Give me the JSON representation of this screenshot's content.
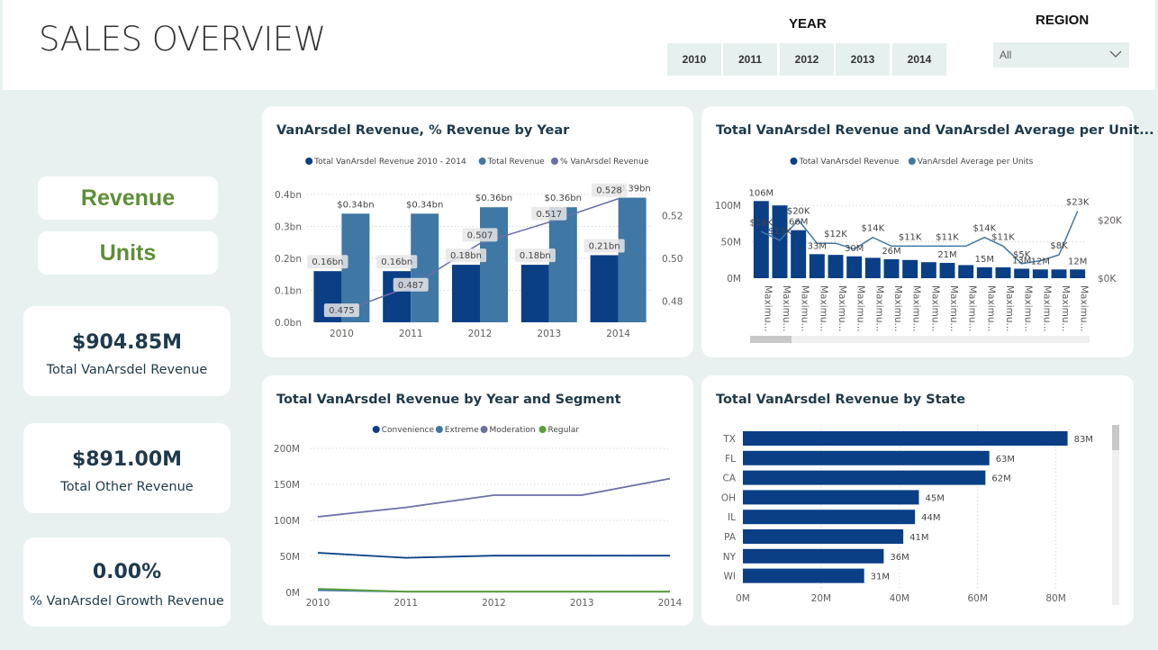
{
  "header": {
    "title": "SALES OVERVIEW",
    "year_slicer": {
      "title": "YEAR",
      "options": [
        "2010",
        "2011",
        "2012",
        "2013",
        "2014"
      ]
    },
    "region_slicer": {
      "title": "REGION",
      "selected": "All"
    }
  },
  "nav": {
    "revenue_label": "Revenue",
    "units_label": "Units"
  },
  "kpis": [
    {
      "value": "$904.85M",
      "label": "Total VanArsdel Revenue"
    },
    {
      "value": "$891.00M",
      "label": "Total Other Revenue"
    },
    {
      "value": "0.00%",
      "label": "% VanArsdel Growth Revenue"
    }
  ],
  "colors": {
    "dark_blue": "#0a3f86",
    "steel_blue": "#3f77a5",
    "purple": "#6b6fa5",
    "green": "#5c9e3b",
    "accent_green": "#5c8f36",
    "background": "#e8f1ef"
  },
  "charts": {
    "revenue_by_year": {
      "title": "VanArsdel Revenue, % Revenue by Year",
      "legend": [
        "Total VanArsdel Revenue 2010 - 2014",
        "Total Revenue",
        "% VanArsdel Revenue"
      ],
      "y_ticks": [
        "0.4bn",
        "0.3bn",
        "0.2bn",
        "0.1bn",
        "0.0bn"
      ],
      "y2_ticks": [
        "0.52",
        "0.50",
        "0.48"
      ]
    },
    "revenue_avg_per_unit": {
      "title": "Total VanArsdel Revenue and VanArsdel Average per Unit...",
      "legend": [
        "Total VanArsdel Revenue",
        "VanArsdel Average per Units"
      ],
      "y_ticks": [
        "100M",
        "50M",
        "0M"
      ],
      "y2_ticks": [
        "$20K",
        "$0K"
      ]
    },
    "revenue_by_segment": {
      "title": "Total VanArsdel Revenue by Year and Segment",
      "legend": [
        "Convenience",
        "Extreme",
        "Moderation",
        "Regular"
      ]
    },
    "revenue_by_state": {
      "title": "Total VanArsdel Revenue by State"
    }
  },
  "chart_data": [
    {
      "type": "bar",
      "title": "VanArsdel Revenue, % Revenue by Year",
      "categories": [
        "2010",
        "2011",
        "2012",
        "2013",
        "2014"
      ],
      "series": [
        {
          "name": "Total VanArsdel Revenue 2010 - 2014",
          "kind": "bar",
          "values": [
            0.16,
            0.16,
            0.18,
            0.18,
            0.21
          ],
          "labels": [
            "0.16bn",
            "0.16bn",
            "0.18bn",
            "0.18bn",
            "0.21bn"
          ]
        },
        {
          "name": "Total Revenue",
          "kind": "bar",
          "values": [
            0.34,
            0.34,
            0.36,
            0.36,
            0.39
          ],
          "labels": [
            "$0.34bn",
            "$0.34bn",
            "$0.36bn",
            "$0.36bn",
            "$0.39bn"
          ]
        },
        {
          "name": "% VanArsdel Revenue",
          "kind": "line",
          "axis": "secondary",
          "values": [
            0.475,
            0.487,
            0.507,
            0.517,
            0.528
          ],
          "labels": [
            "0.475",
            "0.487",
            "0.507",
            "0.517",
            "0.528"
          ]
        }
      ],
      "ylim": [
        0,
        0.4
      ],
      "y2lim": [
        0.47,
        0.53
      ]
    },
    {
      "type": "bar",
      "title": "Total VanArsdel Revenue and VanArsdel Average per Unit...",
      "categories": [
        "Maximu...",
        "Maximu...",
        "Maximu...",
        "Maximu...",
        "Maximu...",
        "Maximu...",
        "Maximu...",
        "Maximu...",
        "Maximu...",
        "Maximu...",
        "Maximu...",
        "Maximu...",
        "Maximu...",
        "Maximu...",
        "Maximu...",
        "Maximu...",
        "Maximu...",
        "Maximu..."
      ],
      "series": [
        {
          "name": "Total VanArsdel Revenue",
          "kind": "bar",
          "values": [
            106,
            100,
            66,
            33,
            32,
            30,
            28,
            26,
            25,
            22,
            21,
            18,
            15,
            15,
            13,
            12,
            12,
            12
          ],
          "labels": [
            "106M",
            "",
            "66M",
            "33M",
            "",
            "30M",
            "",
            "26M",
            "",
            "",
            "21M",
            "",
            "15M",
            "",
            "13M",
            "12M",
            "",
            "12M"
          ]
        },
        {
          "name": "VanArsdel Average per Units",
          "kind": "line",
          "axis": "secondary",
          "values": [
            16,
            13,
            20,
            12,
            12,
            10,
            14,
            11,
            11,
            11,
            11,
            11,
            14,
            11,
            5,
            6,
            8,
            23
          ],
          "labels": [
            "$16K",
            "$13K",
            "$20K",
            "",
            "$12K",
            "",
            "$14K",
            "",
            "$11K",
            "",
            "$11K",
            "",
            "$14K",
            "$11K",
            "$5K",
            "",
            "$8K",
            "$23K"
          ]
        }
      ],
      "ylim": [
        0,
        120
      ],
      "y2lim": [
        0,
        30
      ]
    },
    {
      "type": "line",
      "title": "Total VanArsdel Revenue by Year and Segment",
      "x": [
        "2010",
        "2011",
        "2012",
        "2013",
        "2014"
      ],
      "y_ticks": [
        "200M",
        "150M",
        "100M",
        "50M",
        "0M"
      ],
      "series": [
        {
          "name": "Convenience",
          "values": [
            55,
            48,
            51,
            51,
            51
          ]
        },
        {
          "name": "Extreme",
          "values": [
            3,
            1,
            1,
            1,
            1
          ]
        },
        {
          "name": "Moderation",
          "values": [
            105,
            118,
            135,
            135,
            158
          ]
        },
        {
          "name": "Regular",
          "values": [
            5,
            1,
            1,
            1,
            1
          ]
        }
      ],
      "ylim": [
        0,
        200
      ]
    },
    {
      "type": "bar",
      "orientation": "horizontal",
      "title": "Total VanArsdel Revenue by State",
      "categories": [
        "TX",
        "FL",
        "CA",
        "OH",
        "IL",
        "PA",
        "NY",
        "WI"
      ],
      "values": [
        83,
        63,
        62,
        45,
        44,
        41,
        36,
        31
      ],
      "labels": [
        "83M",
        "63M",
        "62M",
        "45M",
        "44M",
        "41M",
        "36M",
        "31M"
      ],
      "x_ticks": [
        "0M",
        "20M",
        "40M",
        "60M",
        "80M"
      ],
      "xlim": [
        0,
        90
      ]
    }
  ]
}
